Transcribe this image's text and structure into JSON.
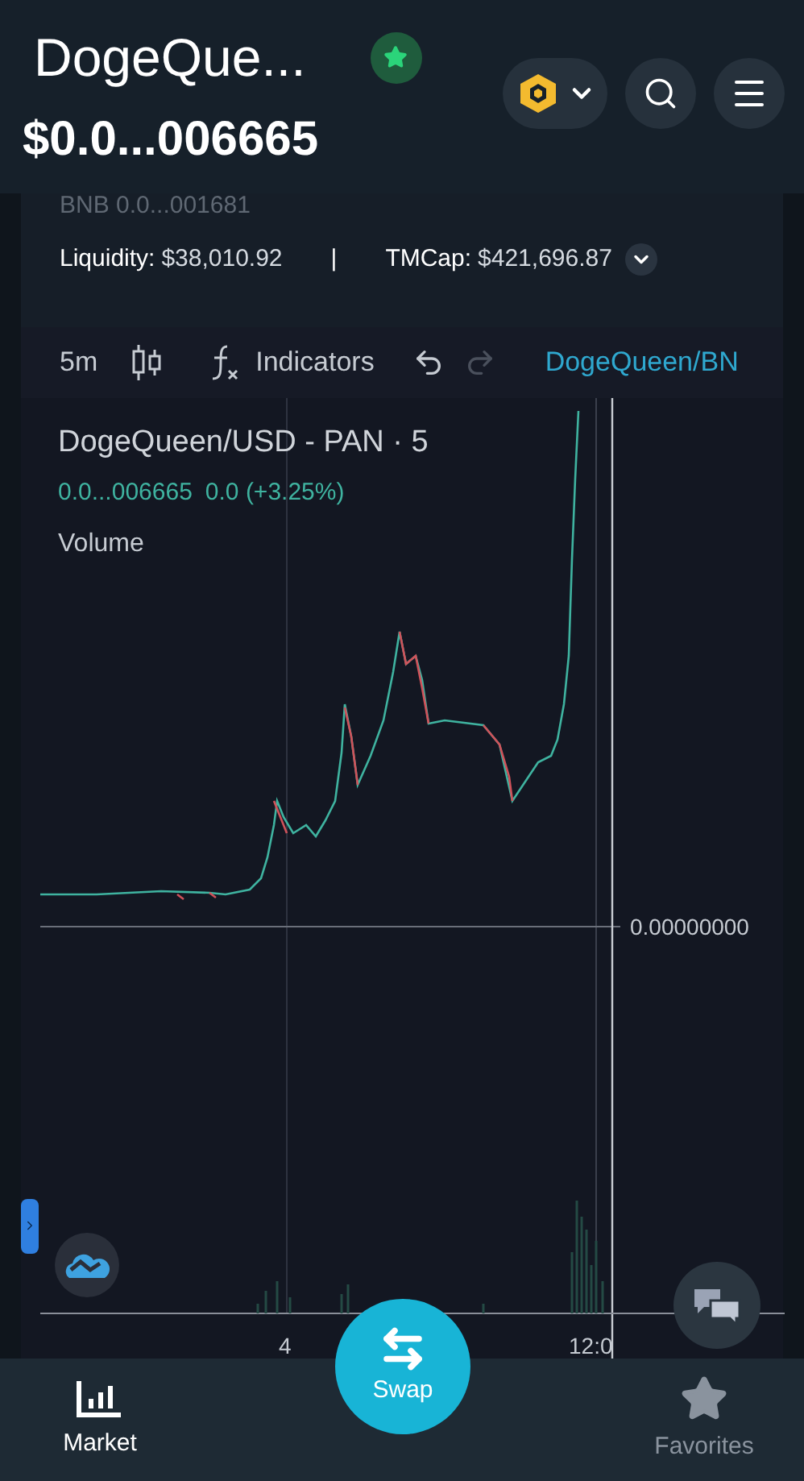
{
  "header": {
    "title": "DogeQue...",
    "price": "$0.0...006665",
    "favorite": true
  },
  "token_info": {
    "bnb_price": "BNB 0.0...001681",
    "liquidity_label": "Liquidity:",
    "liquidity": "$38,010.92",
    "separator": "|",
    "mcap_label": "TMCap:",
    "mcap": "$421,696.87"
  },
  "toolbar": {
    "interval": "5m",
    "indicators": "Indicators",
    "symbol": "DogeQueen/BN"
  },
  "chart": {
    "legend_title": "DogeQueen/USD - PAN · 5",
    "legend_price": "0.0...006665",
    "legend_change": "0.0 (+3.25%)",
    "volume_label": "Volume",
    "price_axis_label": "0.00000000",
    "time_labels": [
      "4",
      "12:0"
    ]
  },
  "nav": [
    {
      "kind": "market",
      "label": "Market",
      "selected": true
    },
    {
      "kind": "swap",
      "label": "Swap",
      "selected": false
    },
    {
      "kind": "favorites",
      "label": "Favorites",
      "selected": false
    }
  ]
}
